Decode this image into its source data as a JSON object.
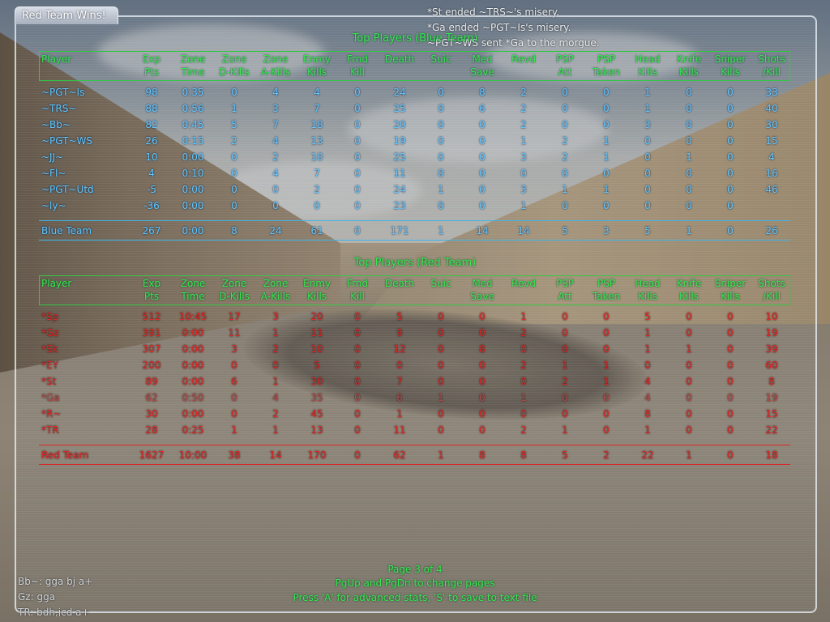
{
  "window": {
    "title": "Red Team Wins!"
  },
  "kill_feed": [
    "*St ended ~TRS~'s misery.",
    "*Ga ended ~PGT~Is's misery.",
    "~PGT~WS sent *Ga to the morgue."
  ],
  "columns": [
    {
      "l1": "Player",
      "l2": ""
    },
    {
      "l1": "Exp",
      "l2": "Pts"
    },
    {
      "l1": "Zone",
      "l2": "Time"
    },
    {
      "l1": "Zone",
      "l2": "D-Kills"
    },
    {
      "l1": "Zone",
      "l2": "A-Kills"
    },
    {
      "l1": "Enmy",
      "l2": "Kills"
    },
    {
      "l1": "Frnd",
      "l2": "Kill"
    },
    {
      "l1": "Death",
      "l2": ""
    },
    {
      "l1": "Suic",
      "l2": ""
    },
    {
      "l1": "Med",
      "l2": "Save"
    },
    {
      "l1": "Revd",
      "l2": ""
    },
    {
      "l1": "PSP",
      "l2": "Att"
    },
    {
      "l1": "PSP",
      "l2": "Taken"
    },
    {
      "l1": "Head",
      "l2": "Kills"
    },
    {
      "l1": "Knife",
      "l2": "Kills"
    },
    {
      "l1": "Sniper",
      "l2": "Kills"
    },
    {
      "l1": "Shots",
      "l2": "/Kill"
    }
  ],
  "blue_team": {
    "title": "Top Players (Blue Team)",
    "color": "#5cc6ff",
    "rows": [
      [
        "~PGT~Is",
        "98",
        "0:35",
        "0",
        "4",
        "4",
        "0",
        "24",
        "0",
        "8",
        "2",
        "0",
        "0",
        "1",
        "0",
        "0",
        "33"
      ],
      [
        "~TRS~",
        "88",
        "0:56",
        "1",
        "3",
        "7",
        "0",
        "25",
        "0",
        "6",
        "2",
        "0",
        "0",
        "1",
        "0",
        "0",
        "40"
      ],
      [
        "~Bb~",
        "82",
        "0:45",
        "5",
        "7",
        "18",
        "0",
        "20",
        "0",
        "0",
        "2",
        "0",
        "0",
        "3",
        "0",
        "0",
        "30"
      ],
      [
        "~PGT~WS",
        "26",
        "0:15",
        "2",
        "4",
        "13",
        "0",
        "19",
        "0",
        "0",
        "1",
        "2",
        "1",
        "0",
        "0",
        "0",
        "15"
      ],
      [
        "~JJ~",
        "10",
        "0:00",
        "0",
        "2",
        "10",
        "0",
        "25",
        "0",
        "0",
        "3",
        "2",
        "1",
        "0",
        "1",
        "0",
        "4"
      ],
      [
        "~Fl~",
        "4",
        "0:10",
        "0",
        "4",
        "7",
        "0",
        "11",
        "0",
        "0",
        "0",
        "0",
        "0",
        "0",
        "0",
        "0",
        "16"
      ],
      [
        "~PGT~Utd",
        "-5",
        "0:00",
        "0",
        "0",
        "2",
        "0",
        "24",
        "1",
        "0",
        "3",
        "1",
        "1",
        "0",
        "0",
        "0",
        "46"
      ],
      [
        "~ly~",
        "-36",
        "0:00",
        "0",
        "0",
        "0",
        "0",
        "23",
        "0",
        "0",
        "1",
        "0",
        "0",
        "0",
        "0",
        "0",
        ""
      ]
    ],
    "total": [
      "Blue Team",
      "267",
      "0:00",
      "8",
      "24",
      "61",
      "0",
      "171",
      "1",
      "14",
      "14",
      "5",
      "3",
      "5",
      "1",
      "0",
      "26"
    ]
  },
  "red_team": {
    "title": "Top Players (Red Team)",
    "color": "#e12222",
    "rows": [
      [
        "*Sp",
        "512",
        "10:45",
        "17",
        "3",
        "20",
        "0",
        "5",
        "0",
        "0",
        "1",
        "0",
        "0",
        "5",
        "0",
        "0",
        "10"
      ],
      [
        "*Gz",
        "391",
        "0:00",
        "11",
        "1",
        "11",
        "0",
        "9",
        "0",
        "0",
        "2",
        "0",
        "0",
        "1",
        "0",
        "0",
        "19"
      ],
      [
        "*Sk",
        "307",
        "0:00",
        "3",
        "2",
        "10",
        "0",
        "12",
        "0",
        "8",
        "0",
        "0",
        "0",
        "1",
        "1",
        "0",
        "39"
      ],
      [
        "*EY",
        "200",
        "0:00",
        "0",
        "0",
        "5",
        "0",
        "0",
        "0",
        "0",
        "2",
        "1",
        "1",
        "0",
        "0",
        "0",
        "60"
      ],
      [
        "*St",
        "89",
        "0:00",
        "6",
        "1",
        "30",
        "0",
        "7",
        "0",
        "0",
        "0",
        "2",
        "1",
        "4",
        "0",
        "0",
        "8"
      ],
      [
        "*Ga",
        "62",
        "0:50",
        "0",
        "4",
        "35",
        "0",
        "6",
        "1",
        "0",
        "1",
        "0",
        "0",
        "4",
        "0",
        "0",
        "19"
      ],
      [
        "*R~",
        "30",
        "0:00",
        "0",
        "2",
        "45",
        "0",
        "1",
        "0",
        "0",
        "0",
        "0",
        "0",
        "8",
        "0",
        "0",
        "15"
      ],
      [
        "*TR",
        "28",
        "0:25",
        "1",
        "1",
        "13",
        "0",
        "11",
        "0",
        "0",
        "2",
        "1",
        "0",
        "1",
        "0",
        "0",
        "22"
      ]
    ],
    "dim_row_index": 5,
    "total": [
      "Red Team",
      "1627",
      "10:00",
      "38",
      "14",
      "170",
      "0",
      "62",
      "1",
      "8",
      "8",
      "5",
      "2",
      "22",
      "1",
      "0",
      "18"
    ]
  },
  "footer": {
    "page": "Page 3 of 4",
    "nav": "PgUp and PgDn to change pages",
    "hint": "Press 'A' for advanced stats, 'S' to save to text file"
  },
  "chat": [
    "Bb~: gga bj a+",
    "Gz: gga",
    "TR: bdh,jcd a+"
  ],
  "colors": {
    "header_green": "#32e84a",
    "blue": "#5cc6ff",
    "red": "#e12222"
  }
}
